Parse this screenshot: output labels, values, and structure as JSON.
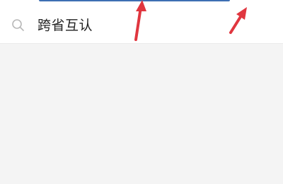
{
  "search": {
    "query": "跨省互认",
    "icon": "search-icon"
  },
  "colors": {
    "accent_strip": "#3d6fb3",
    "annotation_arrow": "#e0363f",
    "background": "#f4f4f4",
    "search_bg": "#ffffff"
  }
}
